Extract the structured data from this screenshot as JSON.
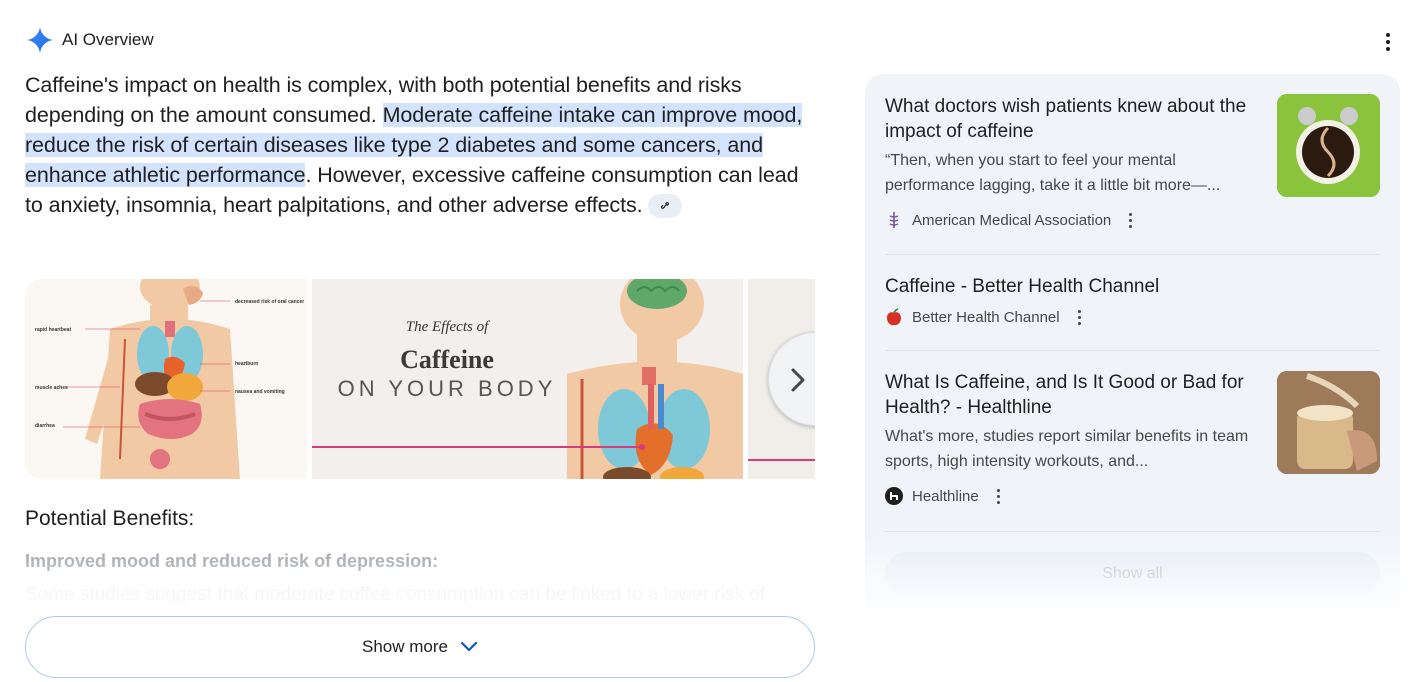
{
  "header": {
    "title": "AI Overview",
    "icon": "sparkle-icon",
    "menu_icon": "more-vert-icon"
  },
  "summary": {
    "part1": "Caffeine's impact on health is complex, with both potential benefits and risks depending on the amount consumed. ",
    "highlight": "Moderate caffeine intake can improve mood, reduce the risk of certain diseases like type 2 diabetes and some cancers, and enhance athletic performance",
    "part2": ". However, excessive caffeine consumption can lead to anxiety, insomnia, heart palpitations, and other adverse effects.",
    "link_icon": "link-icon"
  },
  "images": {
    "image1": {
      "labels": {
        "oral": "decreased risk of oral cancer",
        "heartbeat": "rapid heartbeat",
        "heartburn": "heartburn",
        "muscle": "muscle aches",
        "nausea": "nausea and vomiting",
        "diarrhea": "diarrhea"
      }
    },
    "image2": {
      "line1": "The Effects of",
      "line2": "Caffeine",
      "line3": "ON YOUR BODY"
    },
    "next_icon": "chevron-right-icon"
  },
  "benefits": {
    "heading": "Potential Benefits:",
    "item_title": "Improved mood and reduced risk of depression:",
    "item_text": "Some studies suggest that moderate coffee consumption can be linked to a lower risk of"
  },
  "show_more": {
    "label": "Show more",
    "icon": "chevron-down-icon"
  },
  "sources": [
    {
      "title": "What doctors wish patients knew about the impact of caffeine",
      "snippet": "“Then, when you start to feel your mental performance lagging, take it a little bit more—...",
      "site": "American Medical Association",
      "thumb": "alarm-clock-coffee-image"
    },
    {
      "title": "Caffeine - Better Health Channel",
      "site": "Better Health Channel"
    },
    {
      "title": "What Is Caffeine, and Is It Good or Bad for Health? - Healthline",
      "snippet": "What's more, studies report similar benefits in team sports, high intensity workouts, and...",
      "site": "Healthline",
      "thumb": "latte-pour-image"
    }
  ],
  "show_all": {
    "label": "Show all"
  },
  "colors": {
    "highlight": "#d3e3fd",
    "panel_bg": "#f0f4f9",
    "accent_blue": "#0b57d0",
    "show_more_border": "#a8c7fa"
  }
}
